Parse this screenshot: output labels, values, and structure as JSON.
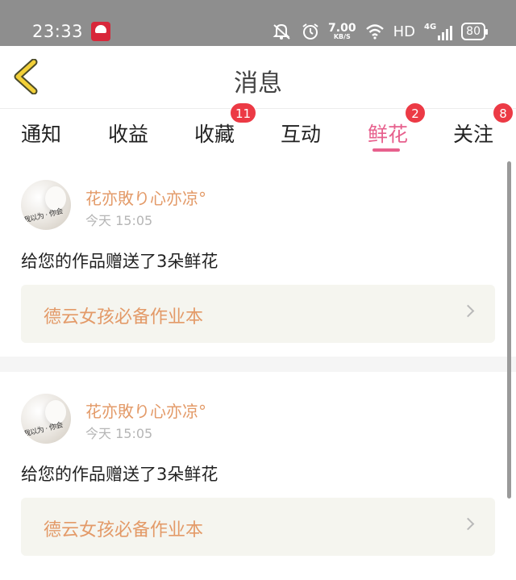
{
  "status_bar": {
    "time": "23:33",
    "network_speed": "7.00",
    "network_speed_unit": "KB/S",
    "hd_label": "HD",
    "signal_label": "4G",
    "battery": "80",
    "icons": [
      "app-notification-icon",
      "mute-icon",
      "alarm-icon",
      "wifi-icon",
      "signal-icon",
      "battery-icon"
    ]
  },
  "header": {
    "title": "消息",
    "back_icon": "chevron-left-icon"
  },
  "tabs": [
    {
      "label": "通知",
      "badge": null,
      "active": false
    },
    {
      "label": "收益",
      "badge": null,
      "active": false
    },
    {
      "label": "收藏",
      "badge": "11",
      "active": false
    },
    {
      "label": "互动",
      "badge": null,
      "active": false
    },
    {
      "label": "鲜花",
      "badge": "2",
      "active": true
    },
    {
      "label": "关注",
      "badge": "8",
      "active": false
    }
  ],
  "feed": [
    {
      "username": "花亦敗り心亦凉°",
      "time": "今天 15:05",
      "message": "给您的作品赠送了3朵鲜花",
      "work_title": "德云女孩必备作业本",
      "avatar_text": "我以为 · 你会懂"
    },
    {
      "username": "花亦敗り心亦凉°",
      "time": "今天 15:05",
      "message": "给您的作品赠送了3朵鲜花",
      "work_title": "德云女孩必备作业本",
      "avatar_text": "我以为 · 你会懂"
    }
  ],
  "colors": {
    "accent": "#e7608d",
    "badge": "#ec3a45",
    "username": "#e39a68",
    "status_bar": "#8e8e8e",
    "back_icon": "#d6b52c"
  }
}
